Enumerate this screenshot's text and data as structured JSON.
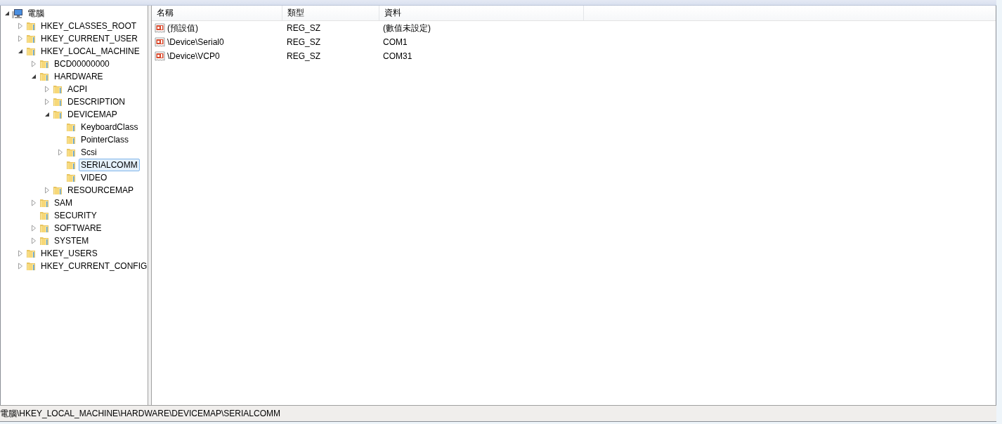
{
  "tree": [
    {
      "label": "電腦",
      "kind": "computer",
      "expanded": true,
      "selected": false,
      "children": [
        {
          "label": "HKEY_CLASSES_ROOT",
          "kind": "folder",
          "expanded": false,
          "selected": false
        },
        {
          "label": "HKEY_CURRENT_USER",
          "kind": "folder",
          "expanded": false,
          "selected": false
        },
        {
          "label": "HKEY_LOCAL_MACHINE",
          "kind": "folder",
          "expanded": true,
          "selected": false,
          "children": [
            {
              "label": "BCD00000000",
              "kind": "folder",
              "expanded": false,
              "selected": false
            },
            {
              "label": "HARDWARE",
              "kind": "folder",
              "expanded": true,
              "selected": false,
              "children": [
                {
                  "label": "ACPI",
                  "kind": "folder",
                  "expanded": false,
                  "selected": false
                },
                {
                  "label": "DESCRIPTION",
                  "kind": "folder",
                  "expanded": false,
                  "selected": false
                },
                {
                  "label": "DEVICEMAP",
                  "kind": "folder",
                  "expanded": true,
                  "selected": false,
                  "children": [
                    {
                      "label": "KeyboardClass",
                      "kind": "folder",
                      "selected": false
                    },
                    {
                      "label": "PointerClass",
                      "kind": "folder",
                      "selected": false
                    },
                    {
                      "label": "Scsi",
                      "kind": "folder",
                      "expanded": false,
                      "selected": false
                    },
                    {
                      "label": "SERIALCOMM",
                      "kind": "folder",
                      "selected": true
                    },
                    {
                      "label": "VIDEO",
                      "kind": "folder",
                      "selected": false
                    }
                  ]
                },
                {
                  "label": "RESOURCEMAP",
                  "kind": "folder",
                  "expanded": false,
                  "selected": false
                }
              ]
            },
            {
              "label": "SAM",
              "kind": "folder",
              "expanded": false,
              "selected": false
            },
            {
              "label": "SECURITY",
              "kind": "folder",
              "selected": false
            },
            {
              "label": "SOFTWARE",
              "kind": "folder",
              "expanded": false,
              "selected": false
            },
            {
              "label": "SYSTEM",
              "kind": "folder",
              "expanded": false,
              "selected": false
            }
          ]
        },
        {
          "label": "HKEY_USERS",
          "kind": "folder",
          "expanded": false,
          "selected": false
        },
        {
          "label": "HKEY_CURRENT_CONFIG",
          "kind": "folder",
          "expanded": false,
          "selected": false
        }
      ]
    }
  ],
  "table": {
    "columns": [
      "名稱",
      "類型",
      "資料"
    ],
    "rows": [
      [
        "(預設值)",
        "REG_SZ",
        "(數值未設定)"
      ],
      [
        "\\Device\\Serial0",
        "REG_SZ",
        "COM1"
      ],
      [
        "\\Device\\VCP0",
        "REG_SZ",
        "COM31"
      ]
    ]
  },
  "status_bar": "電腦\\HKEY_LOCAL_MACHINE\\HARDWARE\\DEVICEMAP\\SERIALCOMM"
}
